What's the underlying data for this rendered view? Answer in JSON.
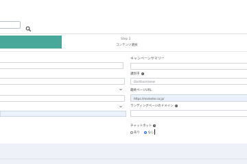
{
  "search": {
    "value": "",
    "placeholder": ""
  },
  "steps": {
    "step1_label": "",
    "step2_number": "Step 2",
    "step2_label": "コンテンツ選択"
  },
  "right": {
    "summary_label": "キャンペーンサマリー",
    "tracking_label": "識別子",
    "tracking_value": "Dashboardview",
    "lp_label": "最終ページURL",
    "lp_value": "https://marketer.co.jp/",
    "domain_label": "ランディングページのドメイン",
    "chatbot_label": "チャットボット",
    "chatbot_options": [
      "あり",
      "なし"
    ],
    "chatbot_selected": "なし"
  },
  "colors": {
    "accent_step": "#48a99b",
    "highlight_input": "#eaf1fb",
    "radio_selected": "#2b6fd6"
  },
  "icons": {
    "search": "search-icon",
    "info": "info-icon",
    "chevron": "chevron-down-icon"
  }
}
